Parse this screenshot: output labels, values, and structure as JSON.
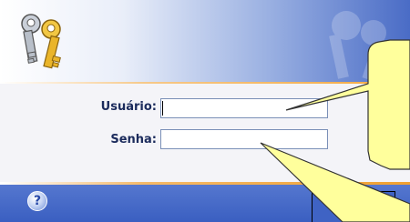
{
  "form": {
    "username_label": "Usuário:",
    "password_label": "Senha:",
    "username_value": "",
    "password_value": ""
  },
  "footer": {
    "help_symbol": "?"
  },
  "icons": {
    "logo": "keys-icon",
    "help": "help-icon"
  },
  "colors": {
    "header_blue": "#4a6cc6",
    "footer_blue": "#3a5fc1",
    "accent_orange": "#f0a030",
    "label_text": "#1b2b5c",
    "callout_fill": "#ffff9c"
  }
}
